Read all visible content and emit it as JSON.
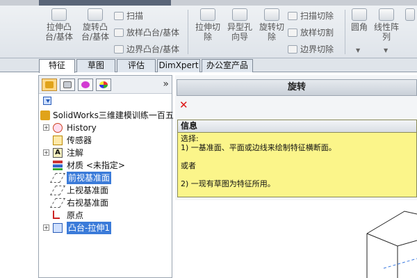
{
  "app": {
    "title_fragment": "SolidWorks"
  },
  "ribbon": {
    "buttons": [
      {
        "label": "拉伸凸\n台/基体",
        "icon": "extrude-boss-icon"
      },
      {
        "label": "旋转凸\n台/基体",
        "icon": "revolve-boss-icon"
      },
      {
        "label": "拉伸切\n除",
        "icon": "extrude-cut-icon"
      },
      {
        "label": "异型孔\n向导",
        "icon": "hole-wizard-icon"
      },
      {
        "label": "旋转切\n除",
        "icon": "revolve-cut-icon"
      },
      {
        "label": "圆角",
        "icon": "fillet-icon"
      },
      {
        "label": "线性阵\n列",
        "icon": "linear-pattern-icon"
      }
    ],
    "small_items": [
      {
        "label": "扫描",
        "icon": "sweep-icon"
      },
      {
        "label": "放样凸台/基体",
        "icon": "loft-icon"
      },
      {
        "label": "边界凸台/基体",
        "icon": "boundary-boss-icon"
      },
      {
        "label": "扫描切除",
        "icon": "swept-cut-icon"
      },
      {
        "label": "放样切割",
        "icon": "lofted-cut-icon"
      },
      {
        "label": "边界切除",
        "icon": "boundary-cut-icon"
      }
    ]
  },
  "tabs": [
    "特征",
    "草图",
    "评估",
    "DimXpert",
    "办公室产品"
  ],
  "left_pane": {
    "expand": "»",
    "tree": [
      {
        "label": "SolidWorks三维建模训练一百五",
        "level": 0,
        "expander": "",
        "icon": "part-icon",
        "highlighted": false
      },
      {
        "label": "History",
        "level": 1,
        "expander": "+",
        "icon": "history-icon",
        "highlighted": false
      },
      {
        "label": "传感器",
        "level": 1,
        "expander": "",
        "icon": "sensor-icon",
        "highlighted": false
      },
      {
        "label": "注解",
        "level": 1,
        "expander": "+",
        "icon": "annotation-icon",
        "highlighted": false
      },
      {
        "label": "材质 <未指定>",
        "level": 1,
        "expander": "",
        "icon": "material-icon",
        "highlighted": false
      },
      {
        "label": "前视基准面",
        "level": 1,
        "expander": "",
        "icon": "plane-icon",
        "highlighted": true
      },
      {
        "label": "上视基准面",
        "level": 1,
        "expander": "",
        "icon": "plane-icon",
        "highlighted": false
      },
      {
        "label": "右视基准面",
        "level": 1,
        "expander": "",
        "icon": "plane-icon",
        "highlighted": false
      },
      {
        "label": "原点",
        "level": 1,
        "expander": "",
        "icon": "origin-icon",
        "highlighted": false
      },
      {
        "label": "凸台-拉伸1",
        "level": 1,
        "expander": "+",
        "icon": "extrude-feature-icon",
        "highlighted": true
      }
    ]
  },
  "property_manager": {
    "title": "旋转",
    "info_title": "信息",
    "info_lines": [
      "选择:",
      "1) 一基准面、平面或边线来绘制特征横断面。",
      "",
      "或者",
      "",
      "2) 一现有草图为特征所用。"
    ]
  },
  "colors": {
    "highlight": "#3b7bd9",
    "info_bg": "#fbf58a"
  }
}
